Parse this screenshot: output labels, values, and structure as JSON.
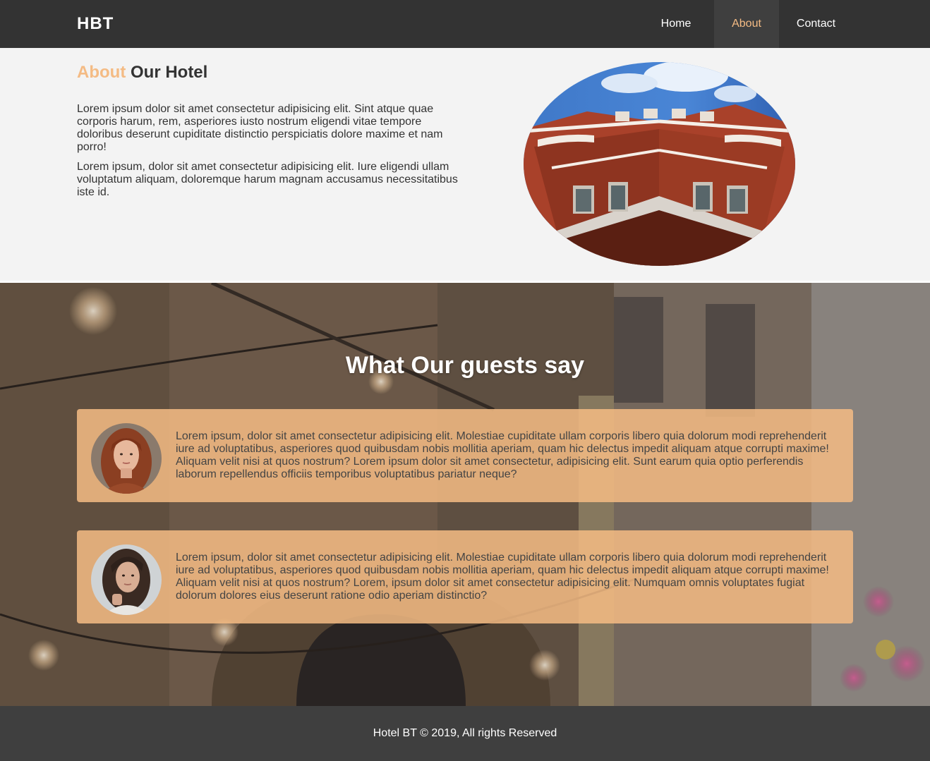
{
  "nav": {
    "logo": "HBT",
    "items": [
      {
        "label": "Home",
        "active": false
      },
      {
        "label": "About",
        "active": true
      },
      {
        "label": "Contact",
        "active": false
      }
    ]
  },
  "about": {
    "title_accent": "About",
    "title_rest": "Our Hotel",
    "paragraphs": [
      "Lorem ipsum dolor sit amet consectetur adipisicing elit. Sint atque quae corporis harum, rem, asperiores iusto nostrum eligendi vitae tempore doloribus deserunt cupiditate distinctio perspiciatis dolore maxime et nam porro!",
      "Lorem ipsum, dolor sit amet consectetur adipisicing elit. Iure eligendi ullam voluptatum aliquam, doloremque harum magnam accusamus necessitatibus iste id."
    ]
  },
  "testimonials": {
    "title": "What Our guests say",
    "items": [
      {
        "quote": "Lorem ipsum, dolor sit amet consectetur adipisicing elit. Molestiae cupiditate ullam corporis libero quia dolorum modi reprehenderit iure ad voluptatibus, asperiores quod quibusdam nobis mollitia aperiam, quam hic delectus impedit aliquam atque corrupti maxime! Aliquam velit nisi at quos nostrum? Lorem ipsum dolor sit amet consectetur, adipisicing elit. Sunt earum quia optio perferendis laborum repellendus officiis temporibus voluptatibus pariatur neque?"
      },
      {
        "quote": "Lorem ipsum, dolor sit amet consectetur adipisicing elit. Molestiae cupiditate ullam corporis libero quia dolorum modi reprehenderit iure ad voluptatibus, asperiores quod quibusdam nobis mollitia aperiam, quam hic delectus impedit aliquam atque corrupti maxime! Aliquam velit nisi at quos nostrum? Lorem, ipsum dolor sit amet consectetur adipisicing elit. Numquam omnis voluptates fugiat dolorum dolores eius deserunt ratione odio aperiam distinctio?"
      }
    ]
  },
  "footer": {
    "text": "Hotel BT © 2019, All rights Reserved"
  },
  "colors": {
    "accent": "#f4bb84",
    "nav_bg": "#333333",
    "footer_bg": "#3f3f3f",
    "page_bg": "#f3f3f3"
  }
}
